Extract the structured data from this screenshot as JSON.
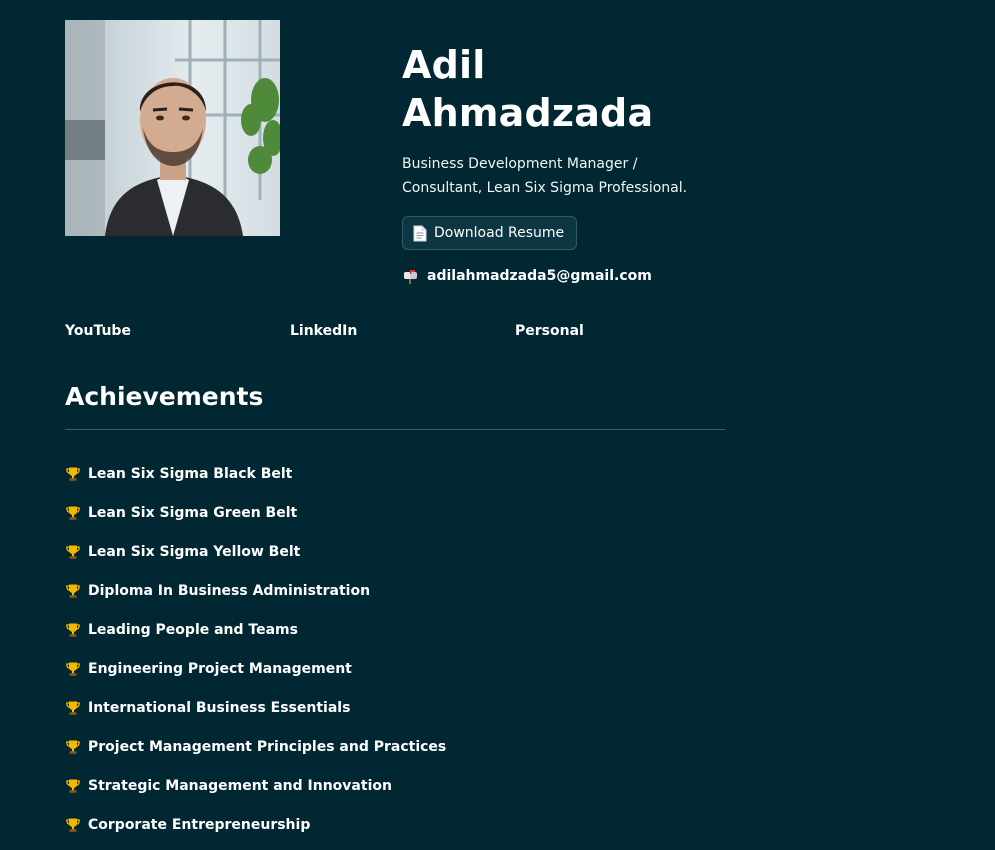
{
  "profile": {
    "photo_alt": "Adil Ahmadzada",
    "name_first": "Adil",
    "name_last": "Ahmadzada",
    "tagline_line1": "Business Development Manager /",
    "tagline_line2": "Consultant, Lean Six Sigma Professional.",
    "resume_label": "Download Resume",
    "resume_icon": "document-icon",
    "email": "adilahmadzada5@gmail.com",
    "email_icon": "mailbox-icon"
  },
  "links": [
    {
      "label": "YouTube"
    },
    {
      "label": "LinkedIn"
    },
    {
      "label": "Personal"
    }
  ],
  "achievements": {
    "title": "Achievements",
    "item_icon": "trophy-icon",
    "items": [
      "Lean Six Sigma Black Belt",
      "Lean Six Sigma Green Belt",
      "Lean Six Sigma Yellow Belt",
      "Diploma In Business Administration",
      "Leading People and Teams",
      "Engineering Project Management",
      "International Business Essentials",
      "Project Management Principles and Practices",
      "Strategic Management and Innovation",
      "Corporate Entrepreneurship"
    ]
  },
  "colors": {
    "background": "#012732",
    "text": "#ffffff",
    "button_bg": "#0b3642",
    "button_border": "#2e5a66",
    "divider": "#3d5f68",
    "trophy": "#f5b800"
  }
}
